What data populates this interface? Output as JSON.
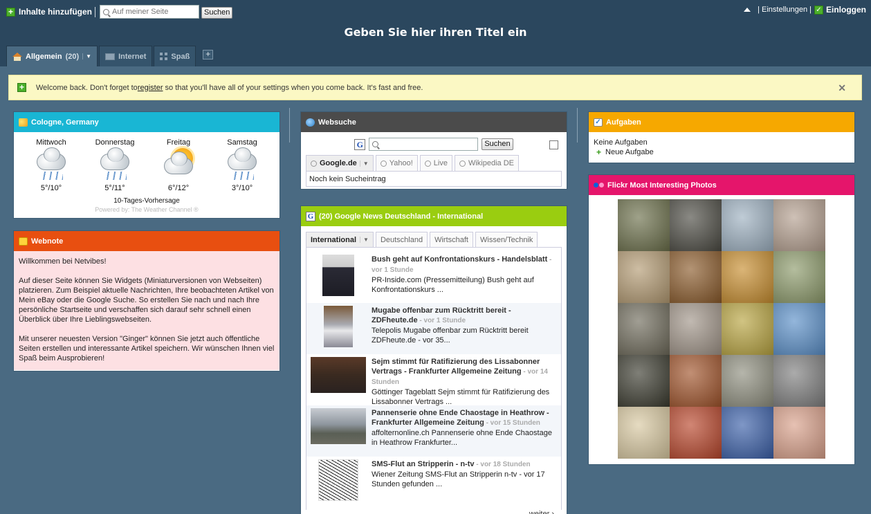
{
  "header": {
    "add_content": "Inhalte hinzufügen",
    "search_placeholder": "Auf meiner Seite",
    "search_button": "Suchen",
    "settings": "| Einstellungen |",
    "login": "Einloggen",
    "title": "Geben Sie hier ihren Titel ein"
  },
  "tabs": [
    {
      "label": "Allgemein",
      "count": "(20)"
    },
    {
      "label": "Internet"
    },
    {
      "label": "Spaß"
    }
  ],
  "welcome": {
    "before": "Welcome back. Don't forget to ",
    "link": "register",
    "after": " so that you'll have all of your settings when you come back. It's fast and free."
  },
  "weather": {
    "title": "Cologne, Germany",
    "days": [
      {
        "name": "Mittwoch",
        "temp": "5°/10°",
        "icon": "rain-icon"
      },
      {
        "name": "Donnerstag",
        "temp": "5°/11°",
        "icon": "rain-icon"
      },
      {
        "name": "Freitag",
        "temp": "6°/12°",
        "icon": "sun-cloud-icon"
      },
      {
        "name": "Samstag",
        "temp": "3°/10°",
        "icon": "rain-icon"
      }
    ],
    "forecast_link": "10-Tages-Vorhersage",
    "powered_by": "Powered by: The Weather Channel ®"
  },
  "webnote": {
    "title": "Webnote",
    "p1": "Willkommen bei Netvibes!",
    "p2": "Auf dieser Seite können Sie Widgets (Miniaturversionen von Webseiten) platzieren. Zum Beispiel aktuelle Nachrichten, Ihre beobachteten Artikel von Mein eBay oder die Google Suche. So erstellen Sie nach und nach Ihre persönliche Startseite und verschaffen sich darauf sehr schnell einen Überblick über Ihre Lieblingswebseiten.",
    "p3": "Mit unserer neuesten Version \"Ginger\" können Sie jetzt auch öffentliche Seiten erstellen und interessante Artikel speichern. Wir wünschen Ihnen viel Spaß beim Ausprobieren!"
  },
  "websuche": {
    "title": "Websuche",
    "button": "Suchen",
    "engines": [
      "Google.de",
      "Yahoo!",
      "Live",
      "Wikipedia DE"
    ],
    "result": "Noch kein Sucheintrag"
  },
  "news": {
    "title": "(20) Google News Deutschland - International",
    "tabs": [
      "International",
      "Deutschland",
      "Wirtschaft",
      "Wissen/Technik"
    ],
    "items": [
      {
        "title": "Bush geht auf Konfrontationskurs - Handelsblatt",
        "age": " - vor 1 Stunde",
        "snippet": "PR-Inside.com (Pressemitteilung) Bush geht auf Konfrontationskurs ..."
      },
      {
        "title": "Mugabe offenbar zum Rücktritt bereit - ZDFheute.de",
        "age": " - vor 1 Stunde",
        "snippet": "Telepolis Mugabe offenbar zum Rücktritt bereit ZDFheute.de - vor 35..."
      },
      {
        "title": "Sejm stimmt für Ratifizierung des Lissabonner Vertrags - Frankfurter Allgemeine Zeitung",
        "age": " - vor 14 Stunden",
        "snippet": "Göttinger Tageblatt Sejm stimmt für Ratifizierung des Lissabonner Vertrags ..."
      },
      {
        "title": "Pannenserie ohne Ende Chaostage in Heathrow - Frankfurter Allgemeine Zeitung",
        "age": " - vor 15 Stunden",
        "snippet": "affolternonline.ch Pannenserie ohne Ende Chaostage in Heathrow Frankfurter..."
      },
      {
        "title": "SMS-Flut an Stripperin - n-tv",
        "age": " - vor 18 Stunden",
        "snippet": "Wiener Zeitung SMS-Flut an Stripperin n-tv - vor 17 Stunden gefunden ..."
      }
    ],
    "more": "weiter"
  },
  "aufgaben": {
    "title": "Aufgaben",
    "empty": "Keine Aufgaben",
    "new_task": "Neue Aufgabe"
  },
  "flickr": {
    "title": "Flickr Most Interesting Photos",
    "photos": [
      "#6b6f4a",
      "#4b4a42",
      "#9db0c0",
      "#b49f8f",
      "#b39a72",
      "#8a5a2a",
      "#c78d2e",
      "#8c9a6a",
      "#6e6a5a",
      "#a09488",
      "#b8a440",
      "#5a8fc8",
      "#3a3a2e",
      "#a0532a",
      "#8e8e7e",
      "#7e7e7e",
      "#d8c8a0",
      "#b8452a",
      "#3a5fa8",
      "#d9a08a"
    ]
  },
  "colors": {
    "weather_header": "#19b6d4",
    "webnote_header": "#e84f10",
    "websuche_header": "#4b4b4b",
    "news_header": "#9acd10",
    "aufgaben_header": "#f6a800",
    "flickr_header": "#e5156b",
    "background": "#4a6a82",
    "topbar": "#2b475e"
  }
}
